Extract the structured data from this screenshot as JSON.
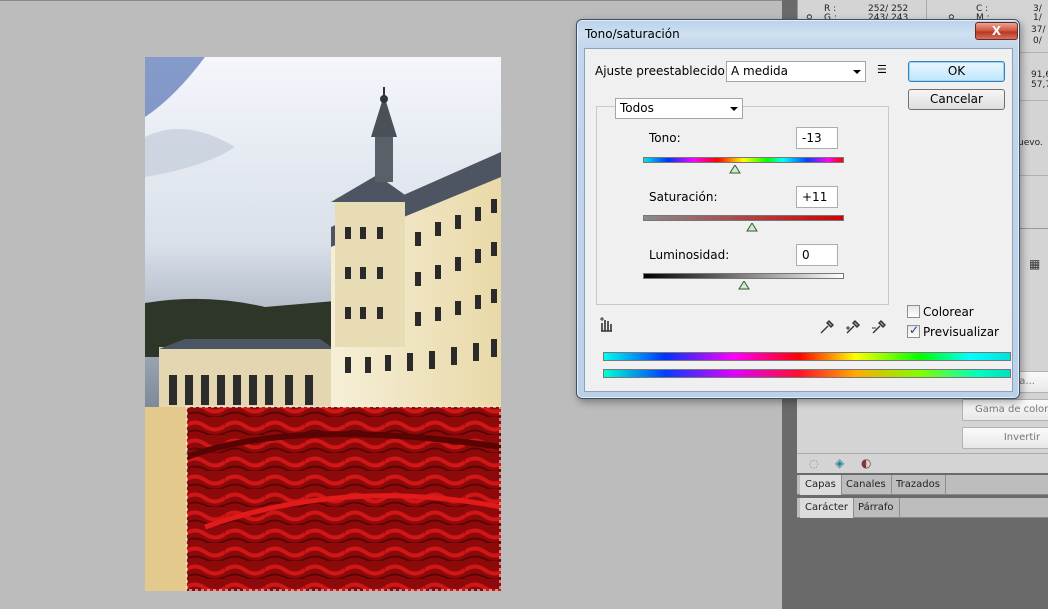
{
  "dialog": {
    "title": "Tono/saturación",
    "close_label": "X",
    "preset_label": "Ajuste preestablecido:",
    "preset_value": "A medida",
    "channel_value": "Todos",
    "ok_label": "OK",
    "cancel_label": "Cancelar",
    "hue": {
      "label": "Tono:",
      "value": "-13",
      "position": 0.46
    },
    "saturation": {
      "label": "Saturación:",
      "value": "+11",
      "position": 0.54
    },
    "lightness": {
      "label": "Luminosidad:",
      "value": "0",
      "position": 0.5
    },
    "colorize_label": "Colorear",
    "colorize_checked": false,
    "preview_label": "Previsualizar",
    "preview_checked": true,
    "icons": [
      "preset-menu-icon",
      "hand-adjust-icon",
      "eyedropper-icon",
      "eyedropper-plus-icon",
      "eyedropper-minus-icon"
    ]
  },
  "info_panel": {
    "rgb_labels": [
      "R :",
      "G :"
    ],
    "rgb_values": [
      "252/  252",
      "243/  243"
    ],
    "cmyk_labels": [
      "C :",
      "M :"
    ],
    "cmyk_values": [
      "3/",
      "1/",
      "37/",
      "0/"
    ],
    "size_values": [
      "91,6",
      "57,7"
    ],
    "note": "uevo."
  },
  "adjust_panel": {
    "buttons": [
      "ara...",
      "Gama de colores...",
      "Invertir"
    ]
  },
  "layers_tabs": [
    "Capas",
    "Canales",
    "Trazados"
  ],
  "char_tabs": [
    "Carácter",
    "Párrafo"
  ],
  "colors": {
    "dialog_accent": "#3c7fb1",
    "close_red": "#c8432d"
  }
}
